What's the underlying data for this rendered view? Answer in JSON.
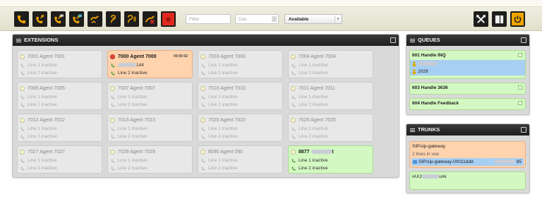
{
  "toolbar": {
    "phone_buttons": [
      {
        "icon": "phone-icon",
        "label": ""
      },
      {
        "icon": "phone-forward-icon",
        "label": ""
      },
      {
        "icon": "phone-hold-icon",
        "label": ""
      },
      {
        "icon": "phone-transfer-icon",
        "label": ""
      },
      {
        "icon": "phone-redirect-icon",
        "label": ""
      },
      {
        "icon": "phone-listen-icon",
        "label": ""
      },
      {
        "icon": "phone-whisper-icon",
        "label": ""
      },
      {
        "icon": "phone-hangup-icon",
        "label": ""
      },
      {
        "icon": "record-stop-icon",
        "label": ""
      }
    ],
    "filter_placeholder": "Filter",
    "dial_placeholder": "Dial",
    "status_select": "Available",
    "accent": "#f0a500",
    "record_color": "#e0281f"
  },
  "extensions": {
    "title": "EXTENSIONS",
    "cards": [
      {
        "title": "7001 Agent 7001",
        "line1": "Line 1 inactive",
        "line2": "Line 2 inactive",
        "state": "idle"
      },
      {
        "title": "7000 Agent 7000",
        "line1": "144",
        "line2": "Line 2 inactive",
        "state": "ringing",
        "timer": "00:00:02"
      },
      {
        "title": "7003 Agent 7003",
        "line1": "Line 1 inactive",
        "line2": "Line 2 inactive",
        "state": "idle"
      },
      {
        "title": "7004 Agent 7004",
        "line1": "Line 1 inactive",
        "line2": "Line 2 inactive",
        "state": "idle"
      },
      {
        "title": "7005 Agent 7005",
        "line1": "Line 1 inactive",
        "line2": "Line 2 inactive",
        "state": "idle"
      },
      {
        "title": "7007 Agent 7007",
        "line1": "Line 1 inactive",
        "line2": "Line 2 inactive",
        "state": "idle"
      },
      {
        "title": "7010 Agent 7010",
        "line1": "Line 1 inactive",
        "line2": "Line 2 inactive",
        "state": "idle"
      },
      {
        "title": "7011 Agent 7011",
        "line1": "Line 1 inactive",
        "line2": "Line 2 inactive",
        "state": "idle"
      },
      {
        "title": "7012 Agent 7012",
        "line1": "Line 1 inactive",
        "line2": "Line 2 inactive",
        "state": "idle"
      },
      {
        "title": "7013 Agent 7013",
        "line1": "Line 1 inactive",
        "line2": "Line 2 inactive",
        "state": "idle"
      },
      {
        "title": "7020 Agent 7020",
        "line1": "Line 1 inactive",
        "line2": "Line 2 inactive",
        "state": "idle"
      },
      {
        "title": "7025 Agent 7025",
        "line1": "Line 1 inactive",
        "line2": "Line 2 inactive",
        "state": "idle"
      },
      {
        "title": "7027 Agent 7027",
        "line1": "Line 1 inactive",
        "line2": "Line 2 inactive",
        "state": "idle"
      },
      {
        "title": "7029 Agent 7029",
        "line1": "Line 1 inactive",
        "line2": "Line 2 inactive",
        "state": "idle"
      },
      {
        "title": "8090 Agent 090",
        "line1": "Line 1 inactive",
        "line2": "Line 2 inactive",
        "state": "idle"
      },
      {
        "title": "8877",
        "title_suffix": "t",
        "line1": "Line 1 inactive",
        "line2": "Line 2 inactive",
        "state": "active"
      }
    ]
  },
  "queues": {
    "title": "QUEUES",
    "items": [
      {
        "name": "601 Handle INQ",
        "members": [
          "",
          "2029"
        ]
      },
      {
        "name": "603 Handle 3636",
        "members": []
      },
      {
        "name": "604 Handle Feedback",
        "members": []
      }
    ]
  },
  "trunks": {
    "title": "TRUNKS",
    "items": [
      {
        "name": "SIP/sip-gateway",
        "sub": "2 lines in use",
        "channel": "SIP/sip-gateway-00011ddd",
        "channel_suffix": "85",
        "state": "busy"
      },
      {
        "name": "IAX2",
        "name_suffix": "unk",
        "state": "idle"
      }
    ]
  }
}
